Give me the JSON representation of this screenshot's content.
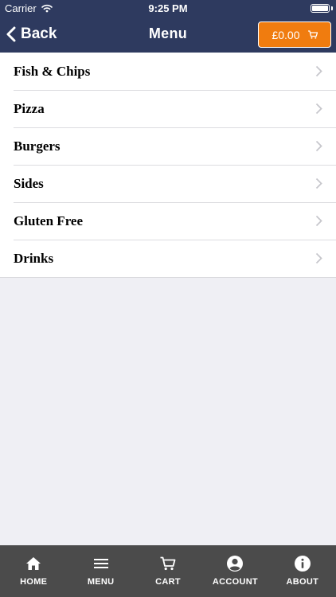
{
  "status_bar": {
    "carrier": "Carrier",
    "time": "9:25 PM"
  },
  "nav": {
    "back_label": "Back",
    "title": "Menu"
  },
  "cart": {
    "amount": "£0.00"
  },
  "menu": {
    "items": [
      {
        "label": "Fish & Chips"
      },
      {
        "label": "Pizza"
      },
      {
        "label": "Burgers"
      },
      {
        "label": "Sides"
      },
      {
        "label": "Gluten Free"
      },
      {
        "label": "Drinks"
      }
    ]
  },
  "tabs": [
    {
      "label": "HOME",
      "icon": "home-icon"
    },
    {
      "label": "MENU",
      "icon": "hamburger-menu-icon"
    },
    {
      "label": "CART",
      "icon": "cart-icon"
    },
    {
      "label": "ACCOUNT",
      "icon": "user-icon"
    },
    {
      "label": "ABOUT",
      "icon": "info-icon"
    }
  ],
  "colors": {
    "header": "#2e3a5f",
    "cart_button": "#f07c0f",
    "background": "#efeff4",
    "tab_bar": "#4b4b4b"
  }
}
